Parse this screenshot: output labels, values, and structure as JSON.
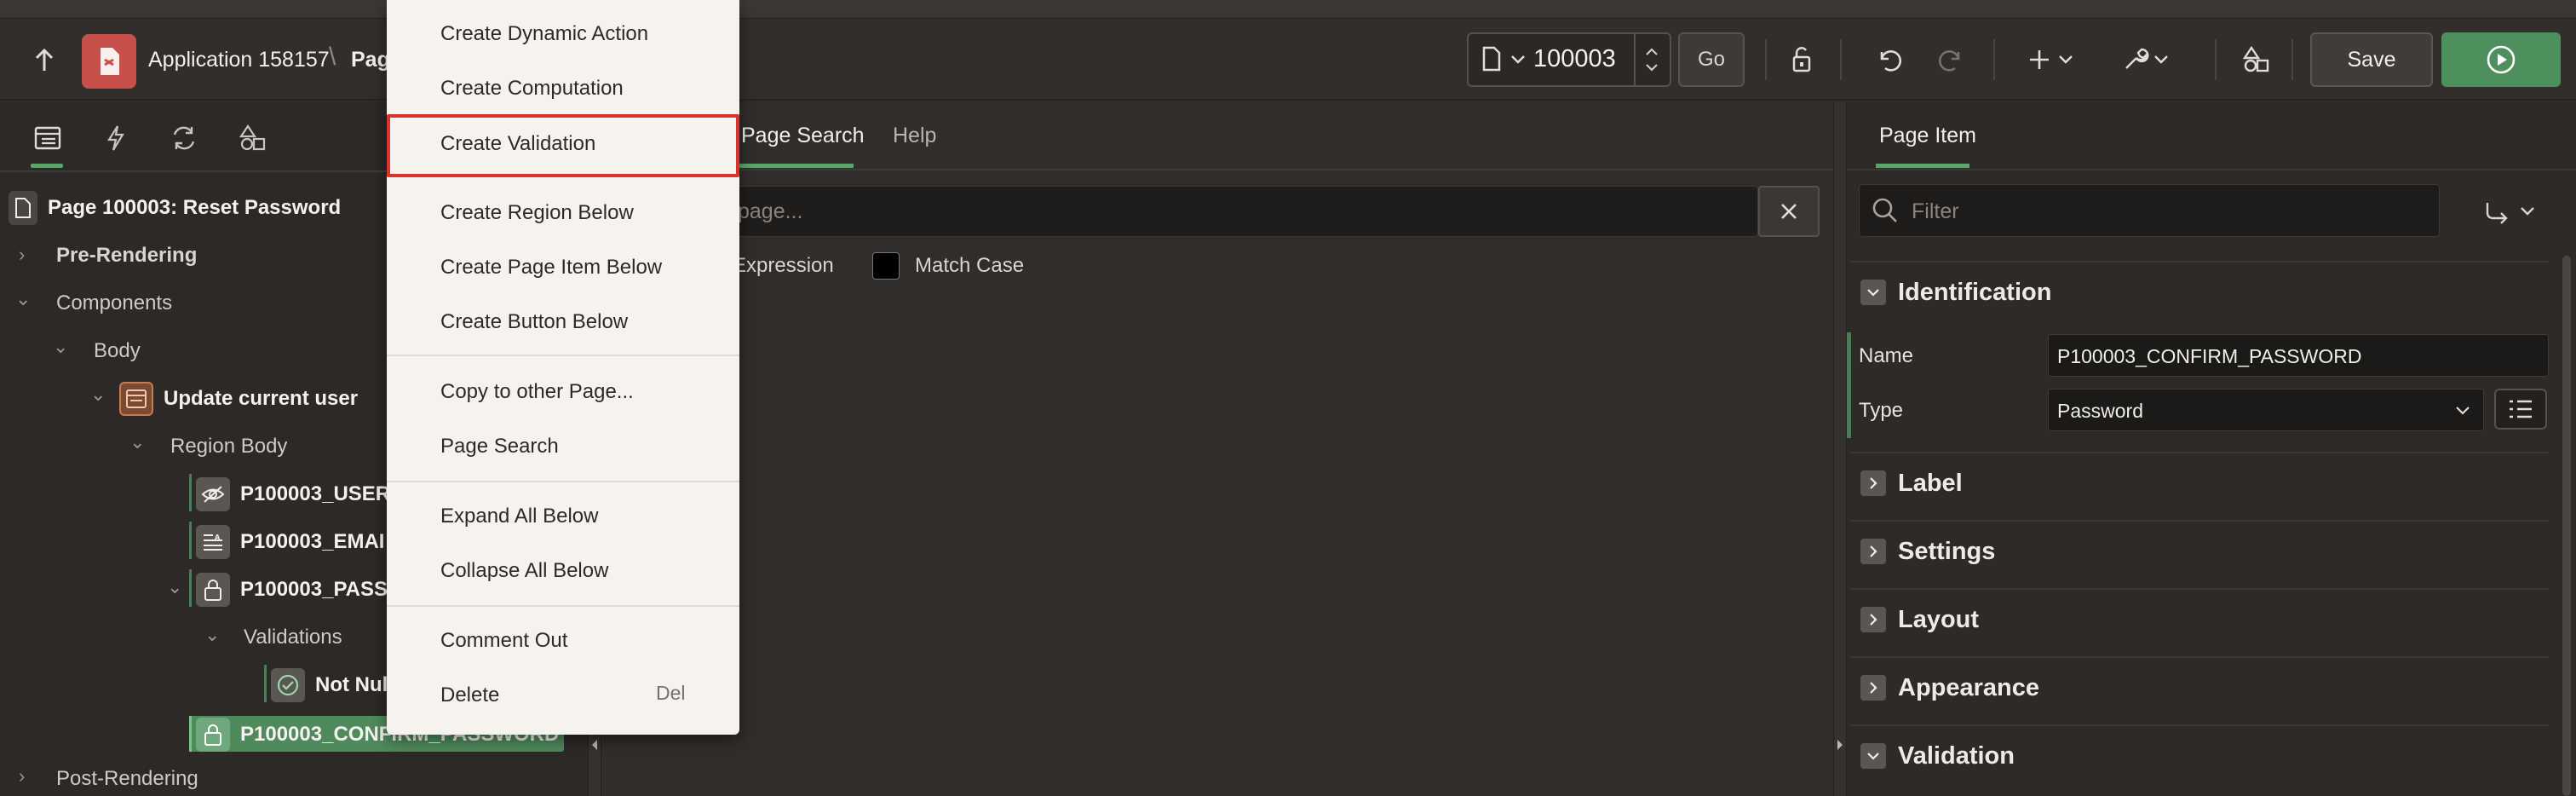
{
  "header": {
    "app_title": "Application 158157",
    "crumb_page": "Page",
    "page_number": "100003",
    "go_label": "Go",
    "save_label": "Save"
  },
  "left_tree": {
    "root": "Page 100003: Reset Password",
    "pre_rendering": "Pre-Rendering",
    "components": "Components",
    "body": "Body",
    "region": "Update current user",
    "region_body": "Region Body",
    "item_user": "P100003_USER",
    "item_email": "P100003_EMAI",
    "item_pass": "P100003_PASS",
    "validations": "Validations",
    "not_null": "Not Nul",
    "item_confirm": "P100003_CONFIRM_PASSWORD",
    "post_rendering": "Post-Rendering"
  },
  "center": {
    "tab_search": "Page Search",
    "tab_help": "Help",
    "search_placeholder": "page...",
    "regex_label": "Expression",
    "match_case_label": "Match Case"
  },
  "context_menu": {
    "items": [
      "Create Dynamic Action",
      "Create Computation",
      "Create Validation",
      "Create Region Below",
      "Create Page Item Below",
      "Create Button Below",
      "Copy to other Page...",
      "Page Search",
      "Expand All Below",
      "Collapse All Below",
      "Comment Out",
      "Delete"
    ],
    "delete_shortcut": "Del",
    "highlighted_item": "Create Validation"
  },
  "right_panel": {
    "tab": "Page Item",
    "filter_placeholder": "Filter",
    "sections": {
      "identification": "Identification",
      "label": "Label",
      "settings": "Settings",
      "layout": "Layout",
      "appearance": "Appearance",
      "validation": "Validation"
    },
    "name_label": "Name",
    "name_value": "P100003_CONFIRM_PASSWORD",
    "type_label": "Type",
    "type_value": "Password"
  },
  "colors": {
    "accent_green": "#5fa36c",
    "run_button": "#4e8f5e",
    "app_icon": "#c7504a",
    "highlight_border": "#d9342b"
  }
}
